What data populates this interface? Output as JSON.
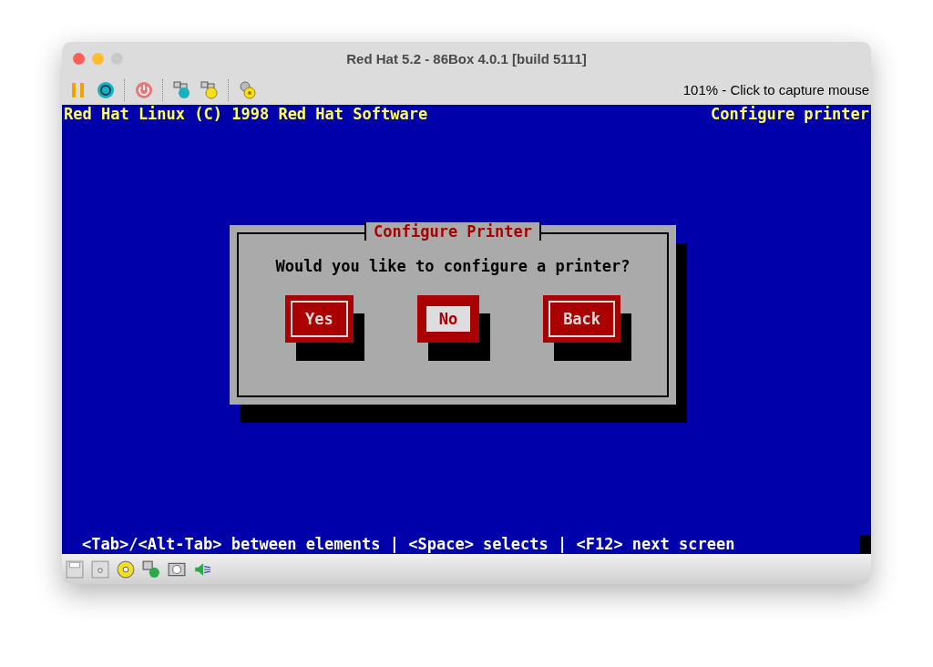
{
  "window": {
    "title": "Red Hat 5.2 - 86Box 4.0.1 [build 5111]"
  },
  "toolbar": {
    "status": "101% - Click to capture mouse"
  },
  "screen": {
    "header_left": "Red Hat Linux (C) 1998 Red Hat Software",
    "header_right": "Configure printer",
    "dialog": {
      "title": "Configure Printer",
      "question": "Would you like to configure a printer?",
      "buttons": [
        {
          "label": "Yes",
          "selected": false
        },
        {
          "label": "No",
          "selected": true
        },
        {
          "label": "Back",
          "selected": false
        }
      ]
    },
    "footer": "<Tab>/<Alt-Tab> between elements  | <Space> selects | <F12> next screen"
  }
}
